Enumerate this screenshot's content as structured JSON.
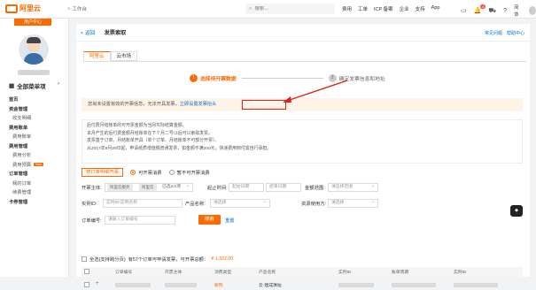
{
  "topbar": {
    "logo": "阿里云",
    "workbench": "工作台",
    "search_placeholder": "搜索...",
    "links": [
      "费用",
      "工单",
      "ICP 备案",
      "企业",
      "支持",
      "App"
    ],
    "lang": "简体",
    "notification_count": "4"
  },
  "sidebar": {
    "user_center": "用户中心",
    "all_menu": "全部菜单项",
    "items": [
      {
        "label": "首页",
        "kind": "group"
      },
      {
        "label": "资金管理",
        "kind": "group"
      },
      {
        "label": "收支明细",
        "kind": "sub"
      },
      {
        "label": "费用账单",
        "kind": "group"
      },
      {
        "label": "费用账单",
        "kind": "sub"
      },
      {
        "label": "费用管理",
        "kind": "group"
      },
      {
        "label": "费用分析",
        "kind": "sub"
      },
      {
        "label": "费用预算",
        "kind": "sub",
        "tag": "New"
      },
      {
        "label": "订单管理",
        "kind": "group"
      },
      {
        "label": "我的订单",
        "kind": "sub"
      },
      {
        "label": "续费管理",
        "kind": "sub"
      },
      {
        "label": "卡券管理",
        "kind": "group"
      }
    ]
  },
  "page": {
    "back": "< 返回",
    "title": "发票索取",
    "head_links": [
      "常见问题",
      "帮助中心"
    ],
    "tabs": [
      "阿里云",
      "云市场"
    ],
    "steps": [
      {
        "num": "1",
        "label": "选择待开票数据"
      },
      {
        "num": "2",
        "label": "确定发票信息和地址"
      }
    ],
    "notice_text": "您尚未设置有效的开票信息，无法开具发票，",
    "notice_link": "立即设置发票抬头",
    "info_lines": [
      "后付费月结账单的可开票金额为当月实际结算金额。",
      "本月产生的后付费金额月结账单在下个月二号以后可以索取发票。",
      "发票基于订单、月结账单开具（单个订单、月结账单不可部分开票）。",
      "从2017年8月29日起，申请纸质增值税普通发票，如金额不满200元，快递费用到付需自行承担。"
    ],
    "order_btn": "按订单明细开票",
    "radio_on": "可开票消费",
    "radio_off": "暂不可开票消费",
    "filters": {
      "invoice_subject_label": "开票主体:",
      "chip_1": "阿里云服务",
      "chip_2": "阿里云",
      "selected_count": "已选2/2项",
      "time_label": "起止时间:",
      "start_placeholder": "起始日期",
      "end_placeholder": "结束日期",
      "amount_label": "金额范围:",
      "amount_placeholder": "请选择范围",
      "instance_label": "实例ID:",
      "instance_placeholder": "实例ID/实例名称",
      "product_label": "产品名称:",
      "product_placeholder": "请选择",
      "region_label": "资源使用方:",
      "region_placeholder": "请选择",
      "order_label": "订单编号:",
      "order_placeholder": "请输入订单编号",
      "search": "搜索",
      "reset": "重置"
    },
    "summary_prefix": "全选(支持跨分页)",
    "summary_mid": "有57个订单可申请发票，可开票总额：",
    "summary_amount": "¥ 1,322.00",
    "table_headers": [
      "订单编号",
      "开票主体",
      "消费类型",
      "产品名称",
      "实例ID",
      "账单周期",
      "实例ID"
    ],
    "row": {
      "type": "新购",
      "product": "云·建成演站"
    },
    "float_icon": "tool-icon"
  },
  "colors": {
    "accent": "#ff6a00",
    "link": "#0070cc",
    "highlight": "#e02020"
  }
}
